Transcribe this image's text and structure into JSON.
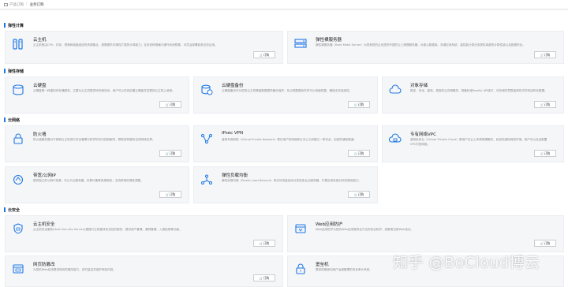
{
  "breadcrumb": {
    "items": [
      "产品订购",
      "业务订购"
    ]
  },
  "order_label": "订购",
  "sections": {
    "compute": {
      "title": "弹性计算",
      "cards": [
        {
          "title": "云主机",
          "desc": "云主机是由CPU、内存、镜像和磁盘组成的资源集合，按需提供可弹性扩展的计算能力；支持多种规格与操作系统镜像，可灵活部署各类业务应用。",
          "icon": "server-icon"
        },
        {
          "title": "弹性裸服务器",
          "desc": "弹性裸服务器（Bare Metal Server）为您和您的企业提供专属的云上物理服务器，为核心数据库、关键应用系统、高性能计算业务提供卓越的计算性能以及数据安全。",
          "icon": "bare-metal-icon"
        }
      ]
    },
    "storage": {
      "title": "弹性存储",
      "cards": [
        {
          "title": "云硬盘",
          "desc": "云硬盘是一种虚拟块存储服务，主要为云主机提供块存储空间，用户可以在线创建云硬盘并挂载到云主机上使用。",
          "icon": "disk-icon"
        },
        {
          "title": "云硬盘备份",
          "desc": "云硬盘备份可为您的云主机硬盘数据提供备份保护，在出现数据丢失时可以快速恢复，确保业务连续性。",
          "icon": "disk-backup-icon"
        },
        {
          "title": "对象存储",
          "desc": "稳定、安全、高效、易用的云存储服务，具备标准Restful API接口，可存储任意数量和形式的非结构化数据。",
          "icon": "object-storage-icon"
        }
      ]
    },
    "network": {
      "title": "云网络",
      "cards": [
        {
          "title": "防火墙",
          "desc": "防火墙服务是对子网和云主机进行安全管理与防护的访问控制服务，帮助您构建安全的网络边界。",
          "icon": "firewall-icon"
        },
        {
          "title": "IPsec VPN",
          "desc": "虚拟专用网络（Virtual Private Network）是在用户的网络和云中心之间建立一条安全、加密的通信隧道。",
          "icon": "vpn-icon"
        },
        {
          "title": "专有网络VPC",
          "desc": "虚拟私有云（Virtual Private Cloud）是用户在云上申请的隔离的、私密的虚拟网络环境。用户可以自由配置VPC内的网络。",
          "icon": "vpc-icon"
        },
        {
          "title": "带宽/公网IP",
          "desc": "提供独立的公网IP资源，可以与云服务器、负载均衡等资源绑定，支持带宽的弹性调整。",
          "icon": "bandwidth-icon"
        },
        {
          "title": "弹性负载均衡",
          "desc": "弹性负载均衡（Elastic Load Balance）将访问流量自动分发到多台云服务器，扩展应用系统对外的服务能力。",
          "icon": "load-balancer-icon"
        }
      ]
    },
    "security": {
      "title": "云安全",
      "cards": [
        {
          "title": "云主机安全",
          "desc": "云主机安全服务(Host Security Service)是提升主机整体安全性的服务，提供资产管理、漏洞管理、入侵检测等功能。",
          "icon": "host-security-icon"
        },
        {
          "title": "Web应用防护",
          "desc": "Web应用防护为您的Web应用提供全方位的安全防护，抵御常见的Web攻击。",
          "icon": "waf-icon"
        },
        {
          "title": "网页防篡改",
          "desc": "为您的Web应用提供网页防篡改能力，实时监控并保护网站内容。",
          "icon": "web-tamper-icon"
        },
        {
          "title": "堡垒机",
          "desc": "堡垒机是面向用户运维管理的安全审计系统。",
          "icon": "bastion-icon"
        }
      ]
    }
  },
  "watermark": "知乎 @BoCloud博云",
  "colors": {
    "accent": "#1e78e6",
    "card_bg": "#f5f6f8",
    "page_bg": "#ffffff"
  }
}
